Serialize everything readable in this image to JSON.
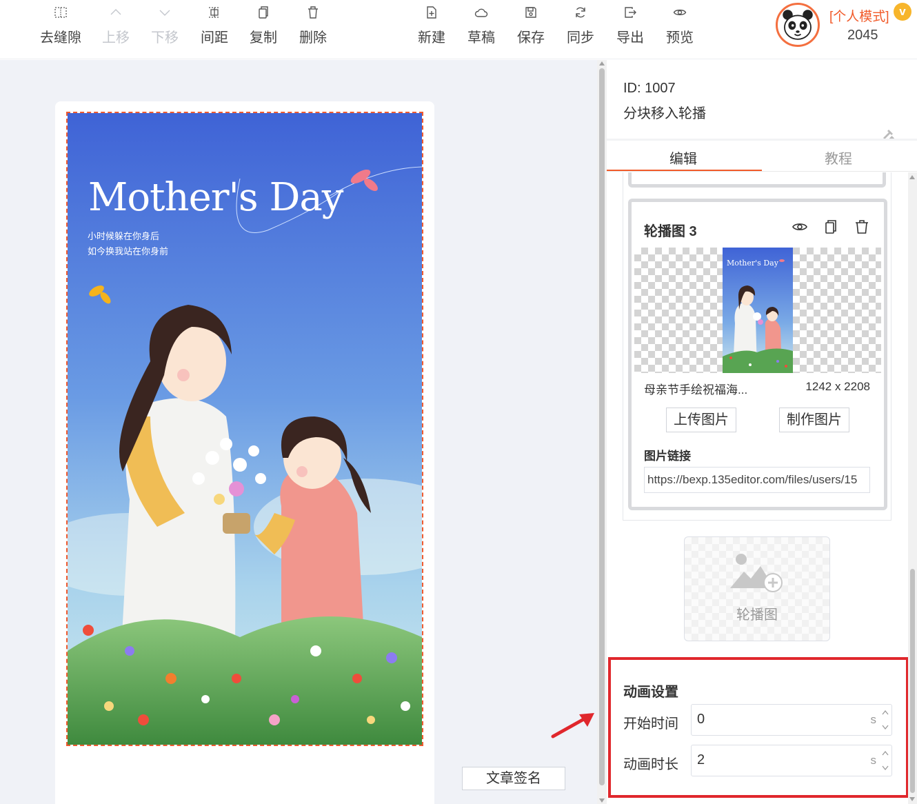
{
  "toolbar": {
    "left_buttons": [
      {
        "label": "去缝隙",
        "icon": "remove-gap-icon",
        "enabled": true
      },
      {
        "label": "上移",
        "icon": "move-up-icon",
        "enabled": false
      },
      {
        "label": "下移",
        "icon": "move-down-icon",
        "enabled": false
      },
      {
        "label": "间距",
        "icon": "spacing-icon",
        "enabled": true
      },
      {
        "label": "复制",
        "icon": "copy-icon",
        "enabled": true
      },
      {
        "label": "删除",
        "icon": "delete-icon",
        "enabled": true
      }
    ],
    "right_buttons": [
      {
        "label": "新建",
        "icon": "new-document-icon"
      },
      {
        "label": "草稿",
        "icon": "cloud-icon"
      },
      {
        "label": "保存",
        "icon": "save-icon"
      },
      {
        "label": "同步",
        "icon": "sync-icon"
      },
      {
        "label": "导出",
        "icon": "export-icon"
      },
      {
        "label": "预览",
        "icon": "eye-icon"
      }
    ]
  },
  "user": {
    "mode_label": "[个人模式]",
    "vip_badge": "v",
    "count": "2045",
    "avatar_icon": "panda-avatar"
  },
  "poster": {
    "title": "Mother's Day",
    "line1": "小时候躲在你身后",
    "line2": "如今换我站在你身前"
  },
  "canvas": {
    "signature_button": "文章签名"
  },
  "panel": {
    "id_label": "ID: 1007",
    "name": "分块移入轮播",
    "tabs": [
      {
        "label": "编辑",
        "active": true
      },
      {
        "label": "教程",
        "active": false
      }
    ],
    "slide": {
      "title": "轮播图 3",
      "thumb_title": "Mother's Day",
      "file_name": "母亲节手绘祝福海...",
      "dimensions": "1242 x 2208",
      "upload_button": "上传图片",
      "make_button": "制作图片",
      "link_label": "图片链接",
      "link_value": "https://bexp.135editor.com/files/users/15"
    },
    "add_slide_label": "轮播图",
    "animation": {
      "title": "动画设置",
      "start_label": "开始时间",
      "start_value": "0",
      "duration_label": "动画时长",
      "duration_value": "2",
      "unit": "s"
    }
  },
  "colors": {
    "accent": "#f15a29",
    "highlight_box": "#e0272c",
    "dashed_border": "#ef5a2f",
    "canvas_bg": "#f0f2f7"
  }
}
